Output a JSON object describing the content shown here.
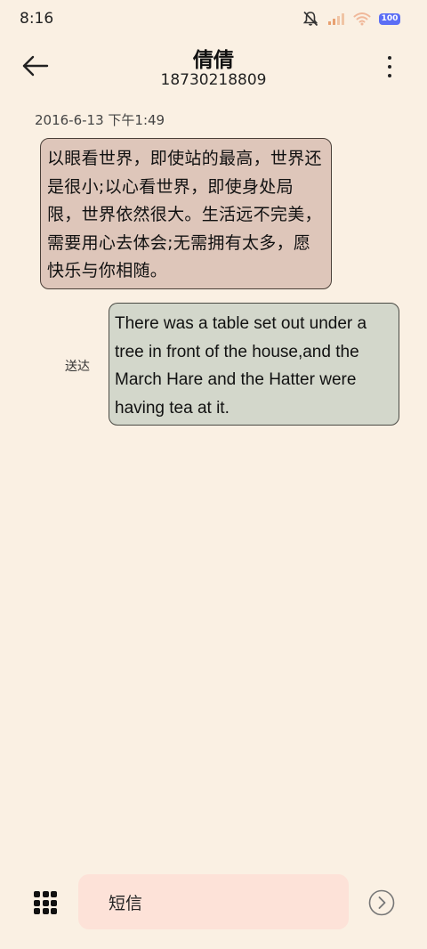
{
  "status_bar": {
    "time": "8:16",
    "battery_level": "100",
    "icons": [
      "mute-icon",
      "signal-icon",
      "wifi-icon",
      "battery-icon"
    ],
    "battery_color": "#5B6EF5"
  },
  "header": {
    "contact_name": "倩倩",
    "contact_number": "18730218809",
    "back_icon": "back-arrow-icon",
    "more_icon": "more-vertical-icon"
  },
  "conversation": {
    "timestamp": "2016-6-13 下午1:49",
    "incoming_message": "以眼看世界，即使站的最高，世界还是很小;以心看世界，即使身处局限，世界依然很大。生活远不完美，需要用心去体会;无需拥有太多，愿快乐与你相随。",
    "outgoing_message": "There was a table set out under a tree in front of the house,and the March Hare and the Hatter were having tea at it.",
    "outgoing_status": "送达",
    "incoming_bubble_color": "#DEC6BA",
    "outgoing_bubble_color": "#D3D7CB"
  },
  "composer": {
    "placeholder": "短信",
    "apps_icon": "grid-apps-icon",
    "send_icon": "send-arrow-icon",
    "input_color": "#FDE2D8"
  },
  "theme": {
    "background": "#FAF0E3"
  }
}
